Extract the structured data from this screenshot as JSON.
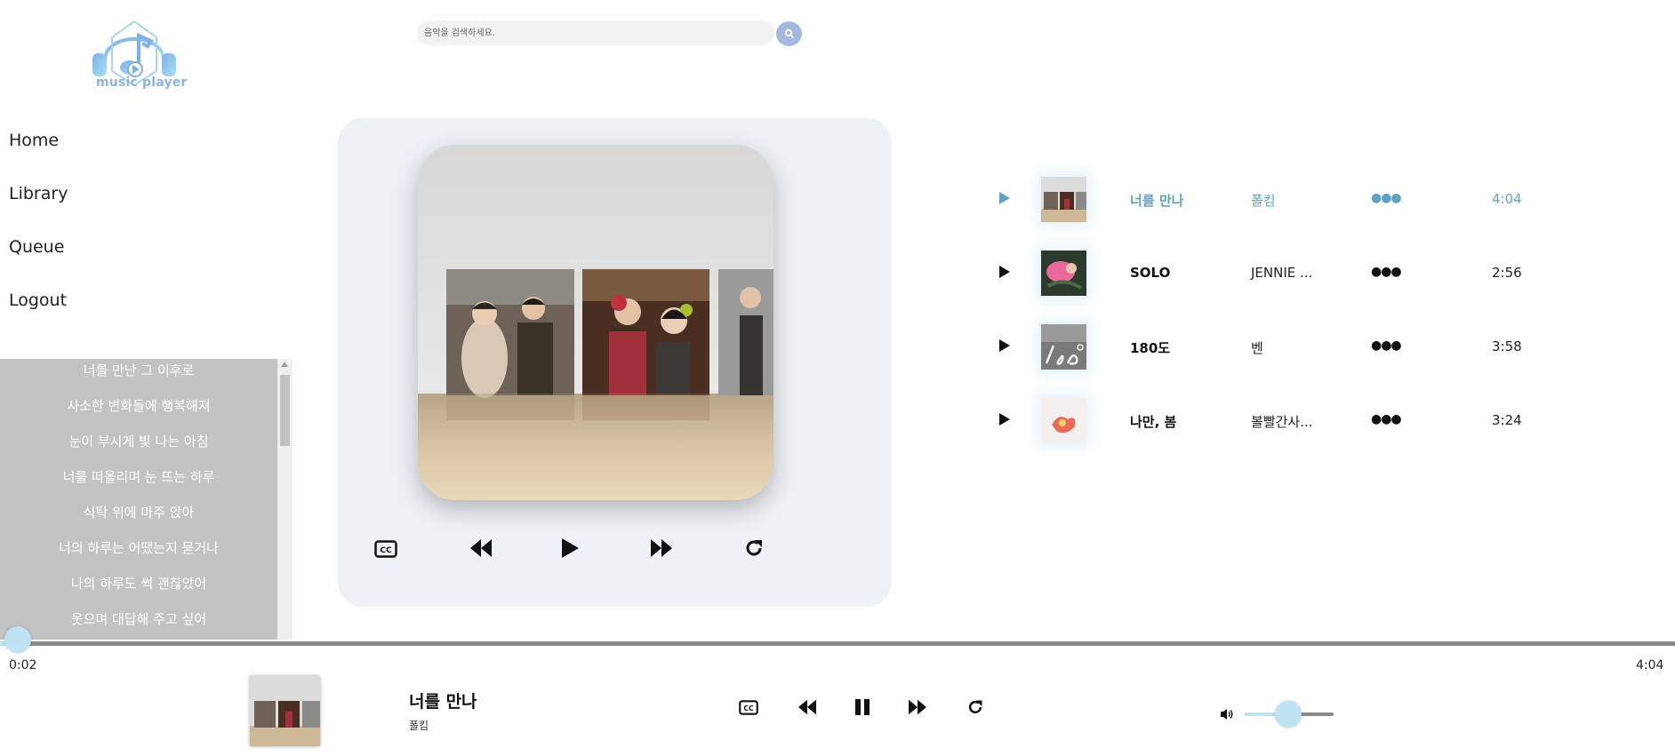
{
  "app": {
    "logo_text": "music player"
  },
  "search": {
    "placeholder": "음악을 검색하세요."
  },
  "nav": {
    "items": [
      {
        "label": "Home"
      },
      {
        "label": "Library"
      },
      {
        "label": "Queue"
      },
      {
        "label": "Logout"
      }
    ]
  },
  "lyrics": [
    "너를 만난 그 이후로",
    "사소한 변화들에 행복해져",
    "눈이 부시게 빛 나는 아침",
    "너를 떠올리며 눈 뜨는 하루",
    "식탁 위에 마주 앉아",
    "너의 하루는 어땠는지 묻거나",
    "나의 하루도 썩 괜찮았어",
    "웃으며 대답해 주고 싶어"
  ],
  "playlist": [
    {
      "title": "너를 만나",
      "artist": "폴킴",
      "more": "●●●",
      "duration": "4:04",
      "active": true
    },
    {
      "title": "SOLO",
      "artist": "JENNIE ...",
      "more": "●●●",
      "duration": "2:56",
      "active": false
    },
    {
      "title": "180도",
      "artist": "벤",
      "more": "●●●",
      "duration": "3:58",
      "active": false
    },
    {
      "title": "나만, 봄",
      "artist": "볼빨간사...",
      "more": "●●●",
      "duration": "3:24",
      "active": false
    }
  ],
  "playback": {
    "current_time": "0:02",
    "total_time": "4:04",
    "progress": 0.008,
    "volume": 0.5
  },
  "now_playing": {
    "title": "너를 만나",
    "artist": "폴킴"
  },
  "colors": {
    "accent": "#bfe3f2",
    "active_text": "#5fa3c2",
    "lyrics_bg": "#c3c3c3",
    "panel_bg": "#eef1f6"
  },
  "icons": {
    "main_controls": [
      "closed-captions-icon",
      "rewind-icon",
      "play-icon",
      "fast-forward-icon",
      "repeat-icon"
    ],
    "bottom_controls": [
      "closed-captions-icon",
      "rewind-icon",
      "pause-icon",
      "fast-forward-icon",
      "repeat-icon",
      "volume-icon"
    ]
  }
}
